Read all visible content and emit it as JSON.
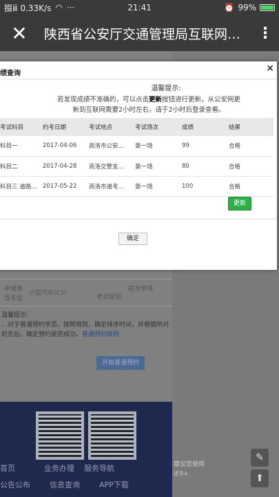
{
  "status_bar": {
    "network": "掇ⅲ 0.33K/s",
    "dots": "···",
    "time": "21:41",
    "battery_pct": "99%",
    "battery_level": 0.99
  },
  "title_bar": {
    "close_glyph": "✕",
    "title": "陕西省公安厅交通管理局互联网…",
    "more_glyph": "⋮"
  },
  "modal": {
    "header": "绩查询",
    "close_glyph": "×",
    "notice_title": "温馨提示:",
    "notice_line1_pre": "若发现成绩不准确的，可以点击",
    "notice_line1_bold": "更新",
    "notice_line1_post": "按钮进行更新，从公安网更",
    "notice_line2": "新到互联网需要2小时左右，请于2小时后登录查看。",
    "columns": [
      "考试科目",
      "约考日期",
      "考试地点",
      "考试场次",
      "成绩",
      "结果"
    ],
    "rows": [
      [
        "科目一",
        "2017-04-06",
        "商洛市公安…",
        "第一场",
        "99",
        "合格"
      ],
      [
        "科目二",
        "2017-04-28",
        "商洛交警支…",
        "第一场",
        "80",
        "合格"
      ],
      [
        "科目三 道路…",
        "2017-05-22",
        "商洛市道考…",
        "第一场",
        "100",
        "合格"
      ]
    ],
    "update_label": "更新",
    "ok_label": "确定"
  },
  "background": {
    "row_label1": "申请准",
    "row_label2": "驾车型",
    "row_value": "小型汽车(C1)",
    "row_label3": "考试原因",
    "row_value3": "初次申领",
    "hint_title": "温馨提示:",
    "hint_line1": "、对于普通预约学员，按照规则，确定排序时间，并根据所对",
    "hint_line2": "的先后，确定预约是否成功。",
    "hint_link": "普通预约规则",
    "start_button": "开始普通预约",
    "footer_links": [
      "首页",
      "业务办理",
      "服务导航",
      "公告公布",
      "信息查询",
      "APP下载"
    ],
    "side_note1": "建议您使用",
    "side_note2": "IE9+."
  },
  "floating": {
    "edit_glyph": "✎",
    "top_glyph": "⬆"
  }
}
